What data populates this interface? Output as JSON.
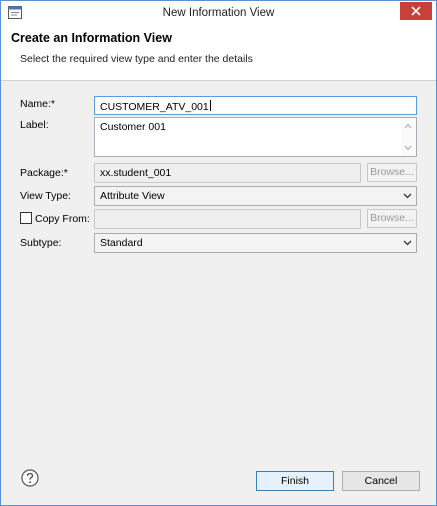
{
  "window": {
    "title": "New Information View"
  },
  "header": {
    "title": "Create an Information View",
    "subtitle": "Select the required view type and enter the details"
  },
  "form": {
    "name": {
      "label": "Name:*",
      "value": "CUSTOMER_ATV_001"
    },
    "label_field": {
      "label": "Label:",
      "value": "Customer 001"
    },
    "package": {
      "label": "Package:*",
      "value": "xx.student_001",
      "browse": "Browse..."
    },
    "view_type": {
      "label": "View Type:",
      "value": "Attribute View"
    },
    "copy_from": {
      "label": "Copy From:",
      "checked": false,
      "value": "",
      "browse": "Browse..."
    },
    "subtype": {
      "label": "Subtype:",
      "value": "Standard"
    }
  },
  "buttons": {
    "finish": "Finish",
    "cancel": "Cancel"
  },
  "icons": {
    "app": "eclipse-window-icon",
    "help": "help-icon",
    "close": "close-icon"
  },
  "colors": {
    "close": "#c7403a",
    "focus_border": "#569de5",
    "default_button_border": "#3c7fb1"
  }
}
